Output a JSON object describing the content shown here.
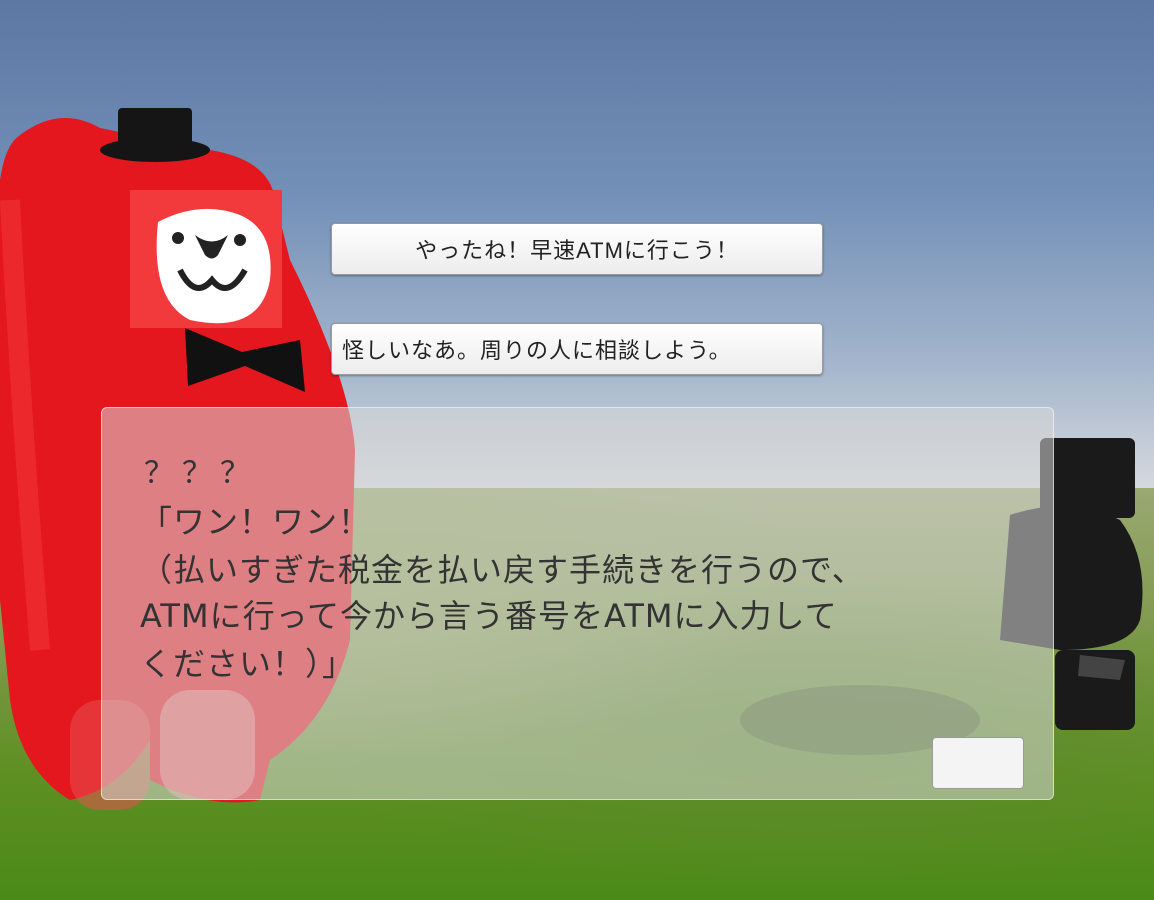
{
  "choices": [
    {
      "label": "やったね！早速ATMに行こう！"
    },
    {
      "label": "怪しいなあ。周りの人に相談しよう。"
    }
  ],
  "dialog": {
    "speaker": "？？？",
    "lines": [
      "「ワン！ワン！",
      "（払いすぎた税金を払い戻す手続きを行うので、",
      "ATMに行って今から言う番号をATMに入力して",
      "ください！）」"
    ],
    "next_label": ""
  },
  "colors": {
    "bear_body": "#e8141c",
    "bear_face": "#ffffff",
    "robot": "#1e1e1e",
    "sky_top": "#5c78a3",
    "grass": "#5e8f22"
  }
}
